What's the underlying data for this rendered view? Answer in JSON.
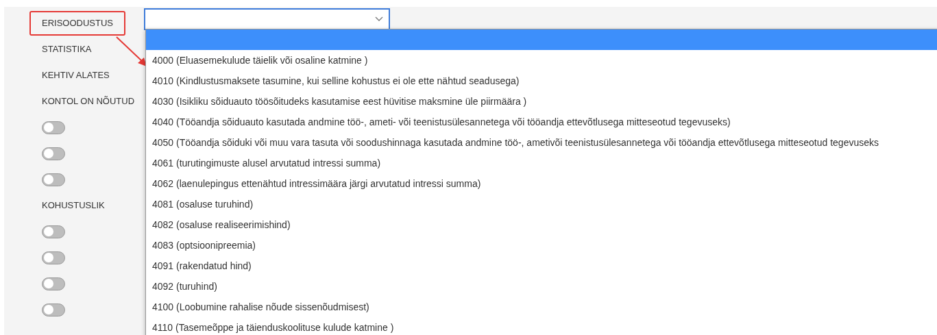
{
  "fields": [
    {
      "kind": "label",
      "text": "ERISOODUSTUS",
      "highlighted": true
    },
    {
      "kind": "label",
      "text": "STATISTIKA",
      "highlighted": false
    },
    {
      "kind": "label",
      "text": "KEHTIV ALATES",
      "highlighted": false
    },
    {
      "kind": "label",
      "text": "KONTOL ON NÕUTUD",
      "highlighted": false
    },
    {
      "kind": "toggle",
      "on": false
    },
    {
      "kind": "toggle",
      "on": false
    },
    {
      "kind": "toggle",
      "on": false
    },
    {
      "kind": "label",
      "text": "KOHUSTUSLIK",
      "highlighted": false
    },
    {
      "kind": "toggle",
      "on": false
    },
    {
      "kind": "toggle",
      "on": false
    },
    {
      "kind": "toggle",
      "on": false
    },
    {
      "kind": "toggle",
      "on": false
    }
  ],
  "select": {
    "open": true,
    "options": [
      {
        "selected": true
      },
      {
        "label": "4000 (Eluasemekulude täielik või osaline katmine )",
        "selected": false
      },
      {
        "label": "4010 (Kindlustusmaksete tasumine, kui selline kohustus ei ole ette nähtud seadusega)",
        "selected": false
      },
      {
        "label": "4030 (Isikliku sõiduauto töösõitudeks kasutamise eest hüvitise maksmine üle piirmäära )",
        "selected": false
      },
      {
        "label": "4040 (Tööandja sõiduauto kasutada andmine töö-, ameti- või teenistusülesannetega või tööandja ettevõtlusega mitteseotud tegevuseks)",
        "selected": false
      },
      {
        "label": "4050 (Tööandja sõiduki või muu vara tasuta või soodushinnaga kasutada andmine töö-, ametivõi teenistusülesannetega või tööandja ettevõtlusega mitteseotud tegevuseks",
        "selected": false
      },
      {
        "label": "4061 (turutingimuste alusel arvutatud intressi summa)",
        "selected": false
      },
      {
        "label": "4062 (laenulepingus ettenähtud intressimäära järgi arvutatud intressi summa)",
        "selected": false
      },
      {
        "label": "4081 (osaluse turuhind)",
        "selected": false
      },
      {
        "label": "4082 (osaluse realiseerimishind)",
        "selected": false
      },
      {
        "label": "4083 (optsioonipreemia)",
        "selected": false
      },
      {
        "label": "4091 (rakendatud hind)",
        "selected": false
      },
      {
        "label": "4092 (turuhind)",
        "selected": false
      },
      {
        "label": "4100 (Loobumine rahalise nõude sissenõudmisest)",
        "selected": false
      },
      {
        "label": "4110 (Tasemeõppe ja täienduskoolituse kulude katmine )",
        "selected": false
      }
    ]
  }
}
